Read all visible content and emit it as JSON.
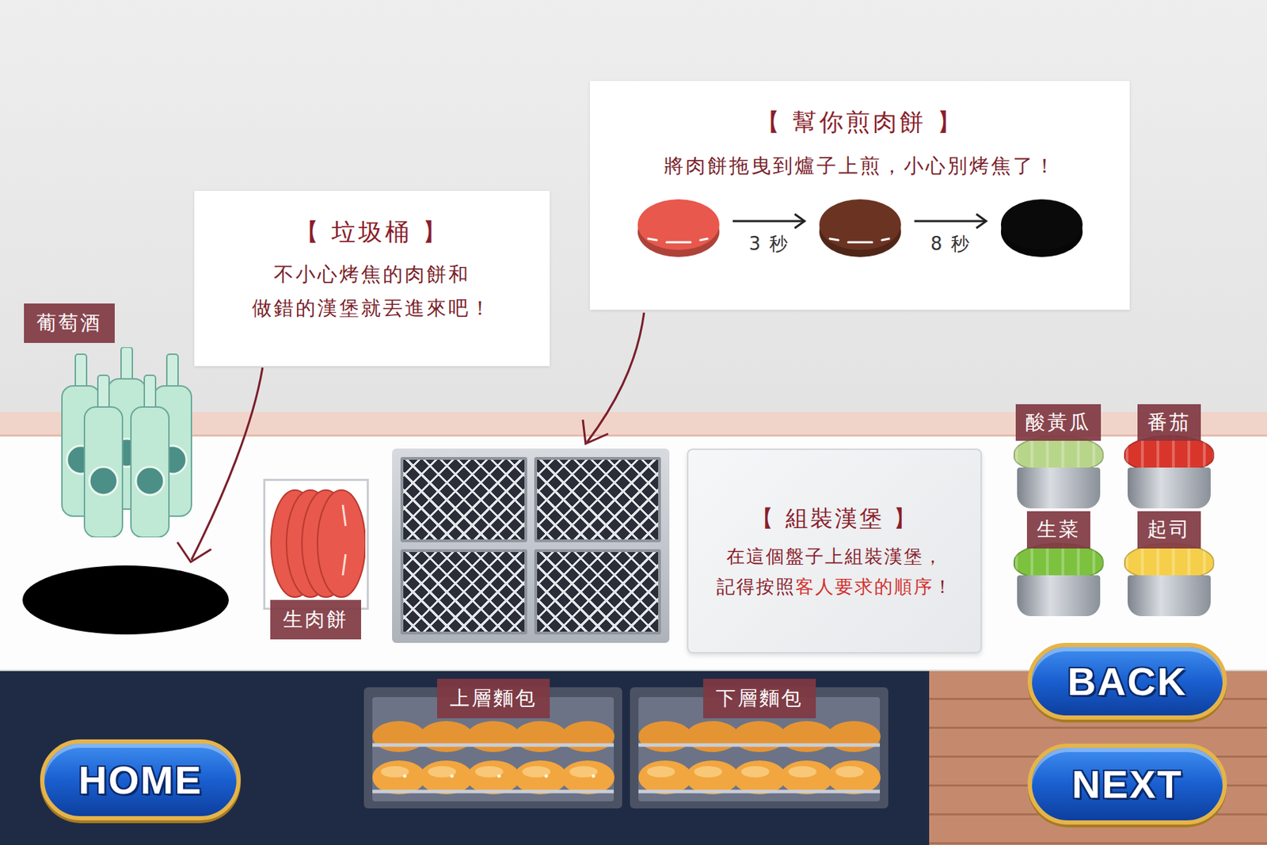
{
  "trash_tip": {
    "title": "【 垃圾桶 】",
    "lines": [
      "不小心烤焦的肉餅和",
      "做錯的漢堡就丟進來吧！"
    ]
  },
  "grill_tip": {
    "title": "【 幫你煎肉餅 】",
    "text": "將肉餅拖曳到爐子上煎，小心別烤焦了！",
    "stages": [
      {
        "kind": "raw",
        "color": "#e8584c"
      },
      {
        "kind": "cooked",
        "color": "#6b3322"
      },
      {
        "kind": "burnt",
        "color": "#0a0a0a"
      }
    ],
    "timings": [
      "3 秒",
      "8 秒"
    ]
  },
  "wine": {
    "label": "葡萄酒"
  },
  "patties": {
    "label": "生肉餅"
  },
  "plate": {
    "title": "【 組裝漢堡 】",
    "lines": [
      [
        {
          "text": "在這個盤子上組裝漢堡，",
          "highlight": false
        }
      ],
      [
        {
          "text": "記得按照",
          "highlight": false
        },
        {
          "text": "客人要求的順序",
          "highlight": true
        },
        {
          "text": "！",
          "highlight": false
        }
      ]
    ]
  },
  "ingredients": [
    {
      "name": "酸黃瓜",
      "color": "#b8d68a"
    },
    {
      "name": "番茄",
      "color": "#d9362b"
    },
    {
      "name": "生菜",
      "color": "#7cc23e"
    },
    {
      "name": "起司",
      "color": "#f5cf4a"
    }
  ],
  "bread": [
    {
      "label": "上層麵包",
      "kind": "top"
    },
    {
      "label": "下層麵包",
      "kind": "bottom"
    }
  ],
  "buttons": {
    "home": "HOME",
    "back": "BACK",
    "next": "NEXT"
  }
}
